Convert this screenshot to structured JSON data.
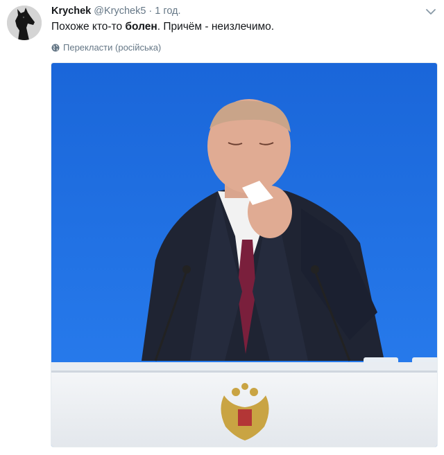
{
  "tweet": {
    "display_name": "Krychek",
    "handle": "@Krychek5",
    "separator": "·",
    "time": "1 год.",
    "text_before": "Похоже кто-то ",
    "text_bold": "болен",
    "text_after": ". Причём - неизлечимо.",
    "translate_label": "Перекласти (російська)"
  },
  "icons": {
    "avatar": "dog-avatar",
    "menu": "chevron-down-icon",
    "translate": "globe-icon"
  },
  "colors": {
    "secondary_text": "#657786",
    "primary_text": "#14171a",
    "photo_background": "#1b6de0"
  }
}
